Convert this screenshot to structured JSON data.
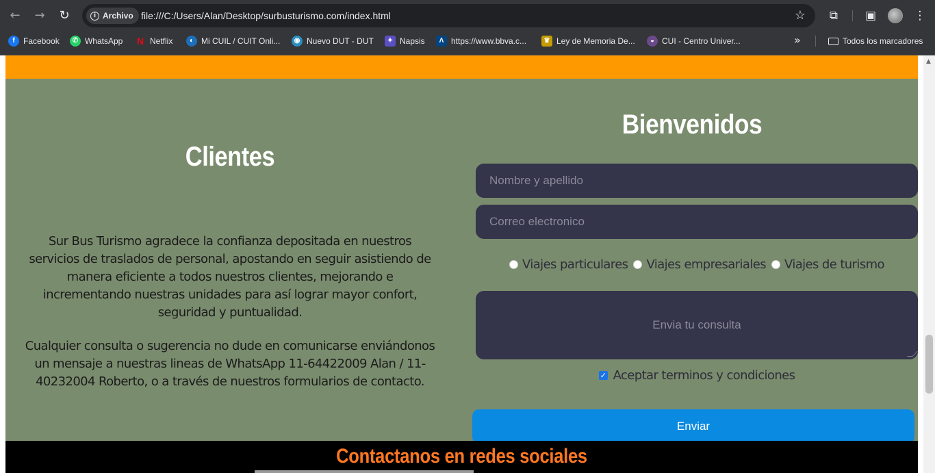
{
  "browser": {
    "nav": {
      "back": "←",
      "forward": "→",
      "reload": "↻"
    },
    "security_chip": "Archivo",
    "url": "file:///C:/Users/Alan/Desktop/surbusturismo.com/index.html",
    "icons": {
      "star": "☆",
      "extensions": "⧉",
      "sidebar": "▣",
      "menu": "⋮"
    },
    "bookmarks": [
      {
        "label": "Facebook",
        "icon": "facebook-icon",
        "color": "#1877f2",
        "glyph": "f"
      },
      {
        "label": "WhatsApp",
        "icon": "whatsapp-icon",
        "color": "#25d366",
        "glyph": "✆"
      },
      {
        "label": "Netflix",
        "icon": "netflix-icon",
        "color": "#e50914",
        "glyph": "N"
      },
      {
        "label": "Mi CUIL / CUIT Onli...",
        "icon": "cuil-icon",
        "color": "#1c6fb8",
        "glyph": "◐"
      },
      {
        "label": "Nuevo DUT - DUT",
        "icon": "dut-icon",
        "color": "#2b8fbf",
        "glyph": "◉"
      },
      {
        "label": "Napsis",
        "icon": "napsis-icon",
        "color": "#5b4fc4",
        "glyph": "✦"
      },
      {
        "label": "https://www.bbva.c...",
        "icon": "bbva-icon",
        "color": "#004481",
        "glyph": "Λ"
      },
      {
        "label": "Ley de Memoria De...",
        "icon": "ley-icon",
        "color": "#c69c00",
        "glyph": "♛"
      },
      {
        "label": "CUI - Centro Univer...",
        "icon": "cui-icon",
        "color": "#6b4a8a",
        "glyph": "◒"
      }
    ],
    "bookmarks_more": "»",
    "all_bookmarks": "Todos los marcadores"
  },
  "page": {
    "clientes": {
      "title": "Clientes",
      "paragraph1": "Sur Bus Turismo agradece la confianza depositada en nuestros servicios de traslados de personal, apostando en seguir asistiendo de manera eficiente a todos nuestros clientes, mejorando e incrementando nuestras unidades para así lograr mayor confort, seguridad y puntualidad.",
      "paragraph2": "Cualquier consulta o sugerencia no dude en comunicarse enviándonos un mensaje a nuestras lineas de WhatsApp 11-64422009 Alan / 11-40232004 Roberto, o a través de nuestros formularios de contacto."
    },
    "form": {
      "title": "Bienvenidos",
      "name_placeholder": "Nombre y apellido",
      "email_placeholder": "Correo electronico",
      "radios": [
        "Viajes particulares",
        "Viajes empresariales",
        "Viajes de turismo"
      ],
      "message_placeholder": "Envia tu consulta",
      "terms_label": "Aceptar terminos y condiciones",
      "terms_checked": true,
      "submit_label": "Enviar"
    },
    "footer_title": "Contactanos en redes sociales",
    "colors": {
      "top_bar": "#ff9900",
      "section_bg": "#7a8c6e",
      "field_bg": "#34344a",
      "button_bg": "#0a8ae0",
      "footer_bg": "#000000",
      "footer_title": "#ff7722"
    }
  }
}
